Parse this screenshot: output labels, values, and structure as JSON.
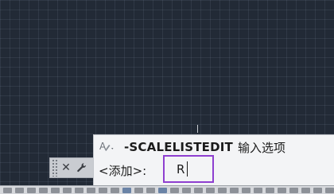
{
  "command": {
    "name": "-SCALELISTEDIT",
    "description": "输入选项",
    "prompt": "<添加>:",
    "input_value": "R",
    "icon": "text-style-icon"
  },
  "toolbar": {
    "close_icon": "close-icon",
    "close_glyph": "✕",
    "settings_icon": "wrench-icon",
    "settings_glyph": "🔧"
  },
  "colors": {
    "canvas_background": "#222a36",
    "command_panel_background": "#f3f4f6",
    "highlight_border": "#8e3fd0"
  }
}
